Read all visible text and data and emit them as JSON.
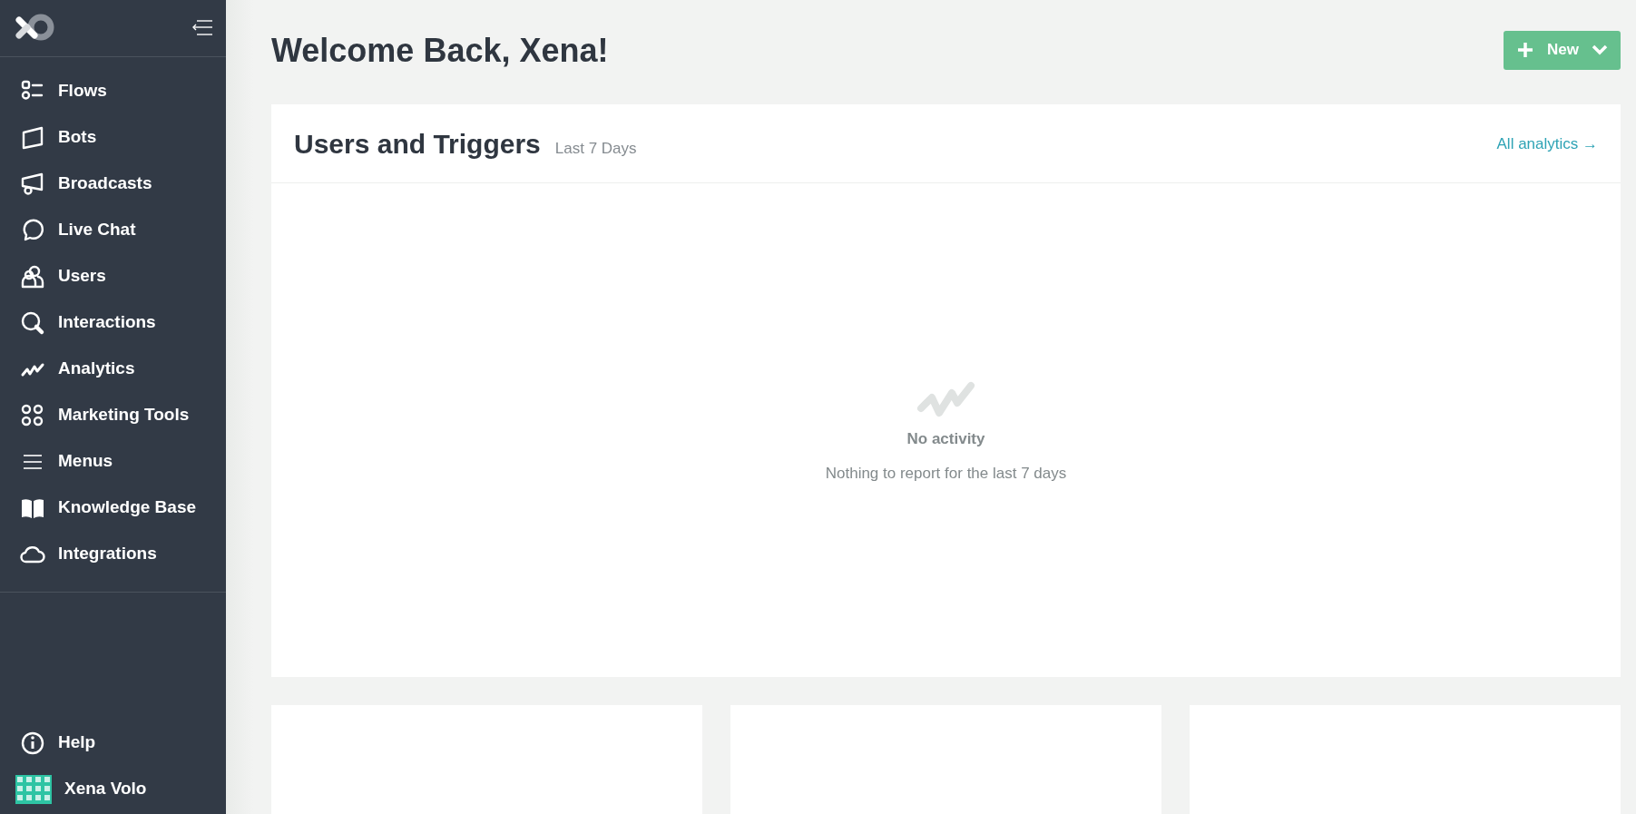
{
  "sidebar": {
    "items": [
      {
        "label": "Flows"
      },
      {
        "label": "Bots"
      },
      {
        "label": "Broadcasts"
      },
      {
        "label": "Live Chat"
      },
      {
        "label": "Users"
      },
      {
        "label": "Interactions"
      },
      {
        "label": "Analytics"
      },
      {
        "label": "Marketing Tools"
      },
      {
        "label": "Menus"
      },
      {
        "label": "Knowledge Base"
      },
      {
        "label": "Integrations"
      }
    ],
    "footer": [
      {
        "kind": "help",
        "label": "Help"
      },
      {
        "kind": "user",
        "label": "Xena Volo"
      }
    ]
  },
  "header": {
    "title": "Welcome Back, Xena!",
    "new_button": "New"
  },
  "card": {
    "title": "Users and Triggers",
    "period": "Last 7 Days",
    "link": "All analytics →",
    "empty_title": "No activity",
    "empty_text": "Nothing to report for the last 7 days"
  },
  "bottom_cards": [
    {
      "kind": "blank"
    },
    {
      "kind": "blank"
    },
    {
      "kind": "blank"
    }
  ]
}
